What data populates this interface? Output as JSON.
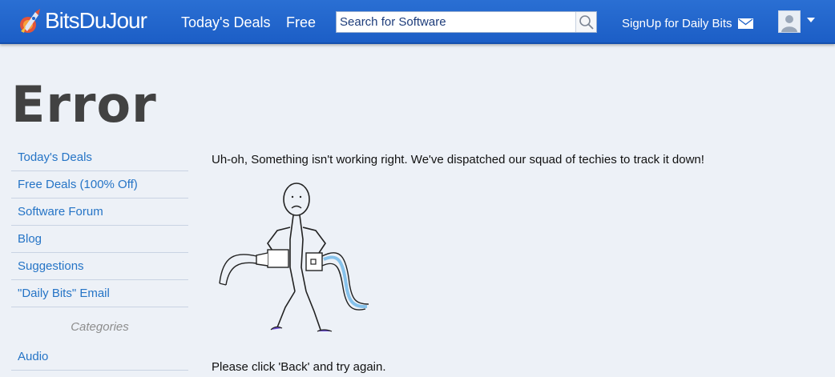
{
  "header": {
    "brand": "BitsDuJour",
    "nav": [
      {
        "label": "Today's Deals"
      },
      {
        "label": "Free"
      }
    ],
    "search": {
      "placeholder": "Search for Software",
      "value": ""
    },
    "signup_label": "SignUp for Daily Bits"
  },
  "page": {
    "title": "Error"
  },
  "sidebar": {
    "items": [
      {
        "label": "Today's Deals"
      },
      {
        "label": "Free Deals (100% Off)"
      },
      {
        "label": "Software Forum"
      },
      {
        "label": "Blog"
      },
      {
        "label": "Suggestions"
      },
      {
        "label": "\"Daily Bits\" Email"
      }
    ],
    "categories_heading": "Categories",
    "categories": [
      {
        "label": "Audio"
      }
    ]
  },
  "main": {
    "error_message": "Uh-oh, Something isn't working right. We've dispatched our squad of techies to track it down!",
    "back_message": "Please click 'Back' and try again."
  },
  "colors": {
    "header_bg": "#1f63c9",
    "link": "#2574c6",
    "page_bg": "#edf1f7",
    "title": "#424242"
  }
}
